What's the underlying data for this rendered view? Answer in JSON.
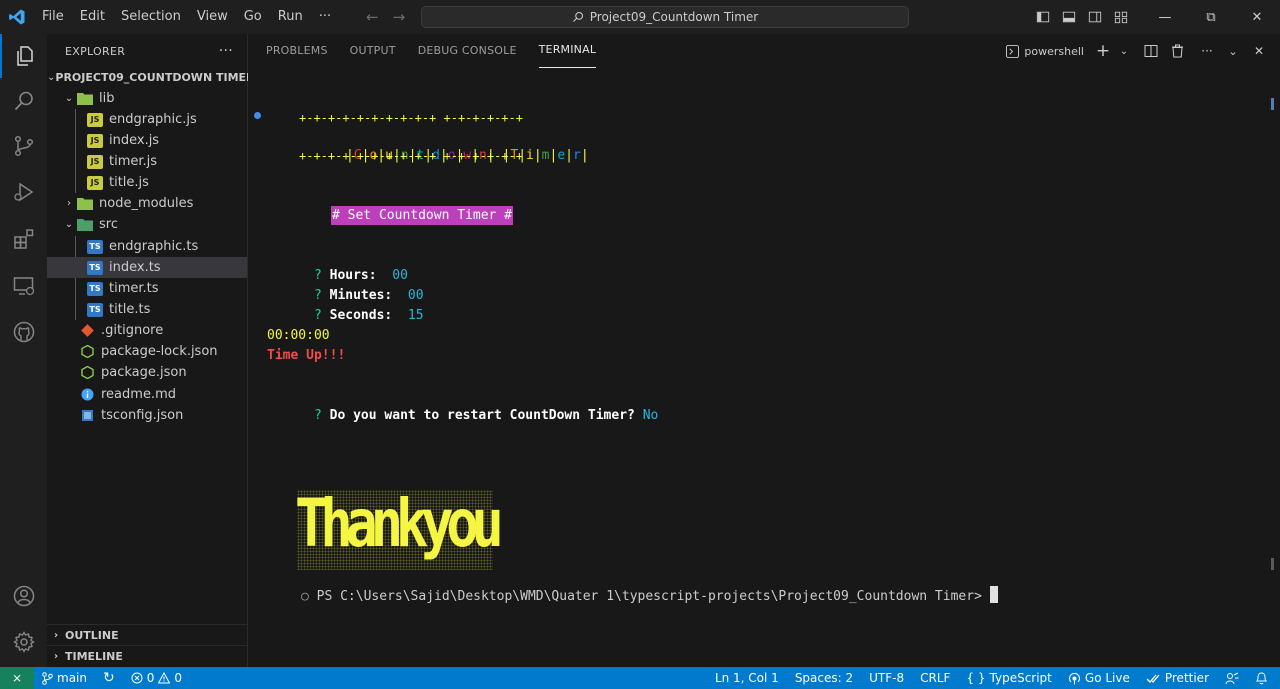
{
  "titlebar": {
    "menu": [
      "File",
      "Edit",
      "Selection",
      "View",
      "Go",
      "Run",
      "···"
    ],
    "search_text": "Project09_Countdown Timer",
    "restore_glyph": "⧉",
    "minimize_glyph": "—",
    "close_glyph": "✕"
  },
  "explorer": {
    "header": "EXPLORER",
    "more": "···",
    "project": "PROJECT09_COUNTDOWN TIMER",
    "items": [
      {
        "label": "lib",
        "kind": "folder",
        "chevron": "⌄"
      },
      {
        "label": "endgraphic.js",
        "kind": "js"
      },
      {
        "label": "index.js",
        "kind": "js"
      },
      {
        "label": "timer.js",
        "kind": "js"
      },
      {
        "label": "title.js",
        "kind": "js"
      },
      {
        "label": "node_modules",
        "kind": "folder",
        "chevron": "›"
      },
      {
        "label": "src",
        "kind": "folder",
        "chevron": "⌄"
      },
      {
        "label": "endgraphic.ts",
        "kind": "ts"
      },
      {
        "label": "index.ts",
        "kind": "ts",
        "selected": true
      },
      {
        "label": "timer.ts",
        "kind": "ts"
      },
      {
        "label": "title.ts",
        "kind": "ts"
      },
      {
        "label": ".gitignore",
        "kind": "git"
      },
      {
        "label": "package-lock.json",
        "kind": "json"
      },
      {
        "label": "package.json",
        "kind": "json"
      },
      {
        "label": "readme.md",
        "kind": "info"
      },
      {
        "label": "tsconfig.json",
        "kind": "tsconfig"
      }
    ],
    "js_badge": "JS",
    "ts_badge": "TS",
    "outline": "OUTLINE",
    "timeline": "TIMELINE"
  },
  "panel": {
    "tabs": [
      "PROBLEMS",
      "OUTPUT",
      "DEBUG CONSOLE",
      "TERMINAL"
    ],
    "active_tab": "TERMINAL",
    "shell": "powershell",
    "plus": "+",
    "chevron": "⌄",
    "more": "···",
    "close": "✕"
  },
  "terminal": {
    "banner_border": "+-+-+-+-+-+-+-+-+-+ +-+-+-+-+-+",
    "banner_word1": [
      "C",
      "o",
      "u",
      "n",
      "t",
      "d",
      "o",
      "w",
      "n"
    ],
    "banner_word2": [
      "T",
      "i",
      "m",
      "e",
      "r"
    ],
    "set_title": "# Set Countdown Timer #",
    "prompts": [
      {
        "q": "?",
        "label": "Hours:",
        "value": "00"
      },
      {
        "q": "?",
        "label": "Minutes:",
        "value": "00"
      },
      {
        "q": "?",
        "label": "Seconds:",
        "value": "15"
      }
    ],
    "time_display": "00:00:00",
    "time_up": "Time Up!!!",
    "restart_q": "?",
    "restart_label": "Do you want to restart CountDown Timer?",
    "restart_answer": "No",
    "thankyou": "Thankyou",
    "ps_prompt": "PS C:\\Users\\Sajid\\Desktop\\WMD\\Quater 1\\typescript-projects\\Project09_Countdown Timer>",
    "circle": "○"
  },
  "statusbar": {
    "branch": "main",
    "errors": "0",
    "warnings": "0",
    "position": "Ln 1, Col 1",
    "spaces": "Spaces: 2",
    "encoding": "UTF-8",
    "eol": "CRLF",
    "language": "TypeScript",
    "golive": "Go Live",
    "prettier": "Prettier",
    "remote_glyph": "⨯",
    "sync_glyph": "↻",
    "braces": "{ }"
  },
  "colors": {
    "accent": "#007acc",
    "rainbow": [
      "#e53935",
      "#fb8c00",
      "#fdd835",
      "#43a047",
      "#00acc1",
      "#1e88e5",
      "#8e24aa",
      "#d81b60",
      "#e53935",
      "#fb8c00",
      "#fdd835",
      "#43a047",
      "#00acc1",
      "#1e88e5"
    ],
    "yellow": "#f5f543",
    "cyan": "#29b8db",
    "red": "#f14c4c",
    "magenta": "#bc3fbc",
    "green": "#23d18b"
  }
}
